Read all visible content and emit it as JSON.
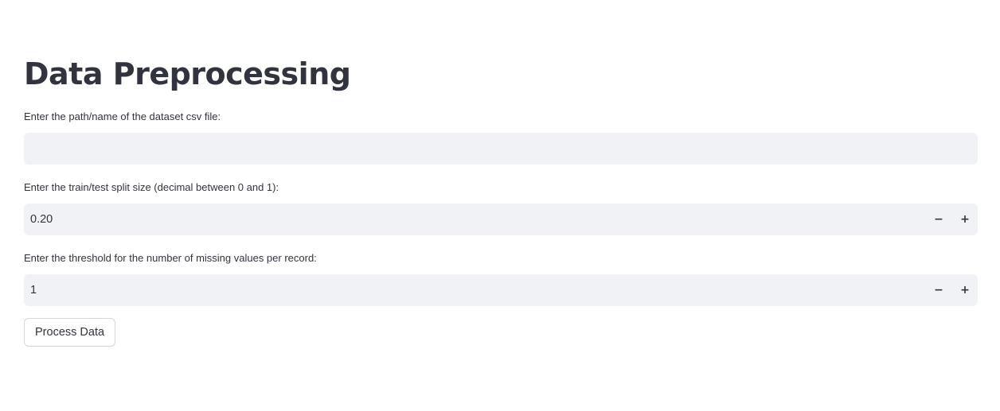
{
  "page": {
    "title": "Data Preprocessing"
  },
  "dataset_path": {
    "label": "Enter the path/name of the dataset csv file:",
    "value": ""
  },
  "split_size": {
    "label": "Enter the train/test split size (decimal between 0 and 1):",
    "value": "0.20",
    "minus_icon": "minus-icon",
    "plus_icon": "plus-icon",
    "minus_glyph": "−",
    "plus_glyph": "+"
  },
  "missing_threshold": {
    "label": "Enter the threshold for the number of missing values per record:",
    "value": "1",
    "minus_glyph": "−",
    "plus_glyph": "+"
  },
  "actions": {
    "process_label": "Process Data"
  },
  "colors": {
    "text": "#31333f",
    "input_background": "#f0f2f6",
    "button_border": "#d6d6d9",
    "background": "#ffffff"
  }
}
